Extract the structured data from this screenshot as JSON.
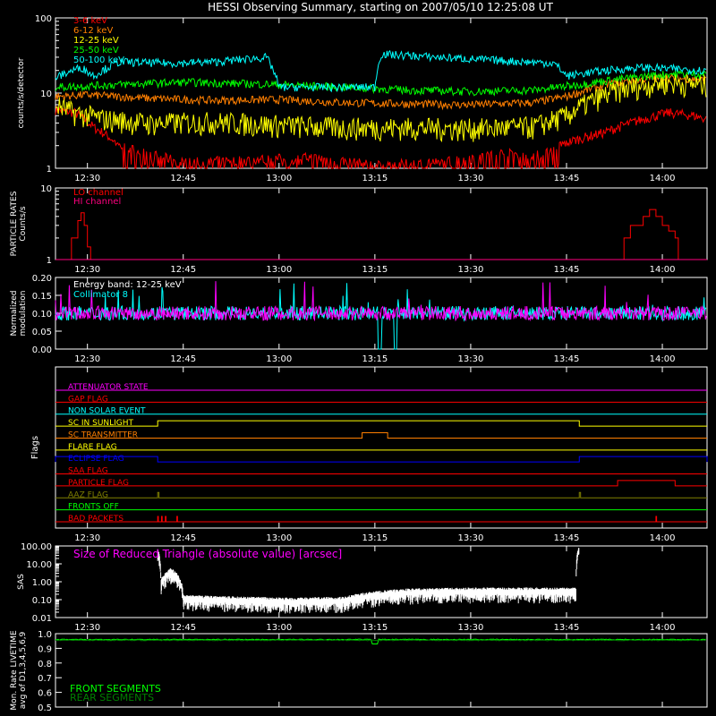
{
  "title": "HESSI Observing Summary, starting on 2007/05/10 12:25:08 UT",
  "time_axis": {
    "start_min": 0,
    "end_min": 102,
    "ticks": [
      {
        "label": "12:30",
        "min": 5
      },
      {
        "label": "12:45",
        "min": 20
      },
      {
        "label": "13:00",
        "min": 35
      },
      {
        "label": "13:15",
        "min": 50
      },
      {
        "label": "13:30",
        "min": 65
      },
      {
        "label": "13:45",
        "min": 80
      },
      {
        "label": "14:00",
        "min": 95
      }
    ]
  },
  "colors": {
    "e3_6": "#ff0000",
    "e6_12": "#ff7f00",
    "e12_25": "#ffff00",
    "e25_50": "#00ff00",
    "e50_100": "#00ffff",
    "lo": "#ff0000",
    "hi": "#ff007f",
    "magenta": "#ff00ff",
    "cyan": "#00ffff"
  },
  "chart_data": [
    {
      "type": "line",
      "ylabel": "counts/s/detector",
      "yscale": "log",
      "ylim": [
        1,
        100
      ],
      "y_ticks": [
        "1",
        "10",
        "100"
      ],
      "series": [
        {
          "name": "3-6 keV",
          "color": "#ff0000",
          "points": [
            [
              0,
              6
            ],
            [
              3,
              5.5
            ],
            [
              6,
              3.5
            ],
            [
              10,
              2
            ],
            [
              14,
              1.6
            ],
            [
              20,
              1.2
            ],
            [
              30,
              1.3
            ],
            [
              40,
              1.4
            ],
            [
              50,
              1.1
            ],
            [
              60,
              1.2
            ],
            [
              70,
              1.6
            ],
            [
              76,
              1.5
            ],
            [
              80,
              2.2
            ],
            [
              86,
              3
            ],
            [
              90,
              4
            ],
            [
              96,
              5.5
            ],
            [
              100,
              5
            ],
            [
              102,
              4.5
            ]
          ]
        },
        {
          "name": "6-12 keV",
          "color": "#ff7f00",
          "points": [
            [
              0,
              9
            ],
            [
              5,
              9.5
            ],
            [
              15,
              8.5
            ],
            [
              25,
              8
            ],
            [
              35,
              8.2
            ],
            [
              45,
              7.5
            ],
            [
              55,
              7.2
            ],
            [
              65,
              7
            ],
            [
              75,
              7.5
            ],
            [
              80,
              9
            ],
            [
              88,
              14
            ],
            [
              95,
              16
            ],
            [
              102,
              15
            ]
          ]
        },
        {
          "name": "12-25 keV",
          "color": "#ffff00",
          "points": [
            [
              0,
              7
            ],
            [
              3,
              5.5
            ],
            [
              8,
              4.5
            ],
            [
              15,
              4
            ],
            [
              25,
              4.2
            ],
            [
              35,
              3.8
            ],
            [
              45,
              3.5
            ],
            [
              55,
              3.5
            ],
            [
              65,
              3.4
            ],
            [
              75,
              3.6
            ],
            [
              80,
              5
            ],
            [
              88,
              11
            ],
            [
              95,
              14
            ],
            [
              102,
              13
            ]
          ]
        },
        {
          "name": "25-50 keV",
          "color": "#00ff00",
          "points": [
            [
              0,
              12
            ],
            [
              10,
              13
            ],
            [
              20,
              14
            ],
            [
              35,
              13
            ],
            [
              45,
              12
            ],
            [
              55,
              11
            ],
            [
              65,
              10.5
            ],
            [
              75,
              11
            ],
            [
              82,
              13
            ],
            [
              90,
              16
            ],
            [
              96,
              18
            ],
            [
              102,
              18
            ]
          ]
        },
        {
          "name": "50-100 keV",
          "color": "#00ffff",
          "points": [
            [
              0,
              16
            ],
            [
              4,
              22
            ],
            [
              6,
              17
            ],
            [
              10,
              26
            ],
            [
              18,
              25
            ],
            [
              25,
              26
            ],
            [
              33,
              30
            ],
            [
              35,
              12
            ],
            [
              50,
              12
            ],
            [
              51,
              33
            ],
            [
              60,
              30
            ],
            [
              70,
              27
            ],
            [
              78,
              25
            ],
            [
              80,
              17
            ],
            [
              86,
              20
            ],
            [
              92,
              22
            ],
            [
              102,
              20
            ]
          ]
        }
      ]
    },
    {
      "type": "line",
      "ylabel": "PARTICLE RATES",
      "ylabel2": "Counts/s",
      "yscale": "log",
      "ylim": [
        1,
        10
      ],
      "y_ticks": [
        "1",
        "10"
      ],
      "series": [
        {
          "name": "LO channel",
          "color": "#ff0000",
          "points": [
            [
              0,
              1
            ],
            [
              2,
              1
            ],
            [
              2.5,
              2
            ],
            [
              3.5,
              3.5
            ],
            [
              4,
              4.5
            ],
            [
              4.5,
              3
            ],
            [
              5,
              1.5
            ],
            [
              5.5,
              1
            ],
            [
              88,
              1
            ],
            [
              89,
              2
            ],
            [
              90,
              3
            ],
            [
              92,
              4
            ],
            [
              93,
              5
            ],
            [
              94,
              4
            ],
            [
              95,
              3
            ],
            [
              96,
              2.5
            ],
            [
              97,
              2
            ],
            [
              97.5,
              1
            ],
            [
              102,
              1
            ]
          ]
        },
        {
          "name": "HI channel",
          "color": "#ff007f",
          "points": [
            [
              0,
              1
            ],
            [
              102,
              1
            ]
          ]
        }
      ]
    },
    {
      "type": "line",
      "ylabel": "Normalized",
      "ylabel2": "modulation",
      "ylim": [
        0,
        0.2
      ],
      "y_ticks": [
        "0.00",
        "0.05",
        "0.10",
        "0.15",
        "0.20"
      ],
      "annotation": "Energy band: 12-25 keV",
      "series": [
        {
          "name": "Collimator 8",
          "color": "#00ffff",
          "mean": 0.1,
          "dropout": [
            [
              50.5,
              51
            ],
            [
              53,
              53.5
            ]
          ]
        }
      ]
    },
    {
      "type": "flags",
      "ylabel": "Flags",
      "flags": [
        {
          "name": "ATTENUATOR STATE",
          "color": "#ff00ff",
          "segments": []
        },
        {
          "name": "GAP FLAG",
          "color": "#ff0000",
          "segments": []
        },
        {
          "name": "NON SOLAR EVENT",
          "color": "#00ffff",
          "segments": []
        },
        {
          "name": "SC IN SUNLIGHT",
          "color": "#ffff00",
          "segments": [
            [
              16,
              82
            ]
          ]
        },
        {
          "name": "SC TRANSMITTER",
          "color": "#ff7f00",
          "segments": [
            [
              48,
              52
            ]
          ]
        },
        {
          "name": "FLARE FLAG",
          "color": "#ffff00",
          "segments": []
        },
        {
          "name": "ECLIPSE FLAG",
          "color": "#0000ff",
          "segments": [
            [
              0,
              16
            ],
            [
              82,
              102
            ]
          ]
        },
        {
          "name": "SAA FLAG",
          "color": "#ff0000",
          "segments": []
        },
        {
          "name": "PARTICLE FLAG",
          "color": "#ff0000",
          "segments": [
            [
              88,
              97
            ]
          ]
        },
        {
          "name": "AAZ FLAG",
          "color": "#808000",
          "segments": [
            [
              16,
              16.2
            ],
            [
              82,
              82.2
            ]
          ]
        },
        {
          "name": "FRONTS OFF",
          "color": "#00ff00",
          "segments": []
        },
        {
          "name": "BAD PACKETS",
          "color": "#ff0000",
          "segments": [
            [
              16,
              16.1
            ],
            [
              16.6,
              16.7
            ],
            [
              17.2,
              17.3
            ],
            [
              19,
              19.1
            ],
            [
              94,
              94.1
            ]
          ]
        }
      ]
    },
    {
      "type": "line",
      "ylabel": "SAS",
      "yscale": "log",
      "ylim": [
        0.01,
        100
      ],
      "y_ticks": [
        "0.01",
        "0.10",
        "1.00",
        "10.00",
        "100.00"
      ],
      "annotation": "Size of Reduced Triangle (absolute value) [arcsec]",
      "series": [
        {
          "name": "SAS",
          "color": "#ffffff",
          "start": 16,
          "end": 82,
          "points": [
            [
              16,
              60
            ],
            [
              16.5,
              1
            ],
            [
              18,
              5
            ],
            [
              20,
              0.15
            ],
            [
              35,
              0.11
            ],
            [
              45,
              0.12
            ],
            [
              50,
              0.25
            ],
            [
              55,
              0.35
            ],
            [
              65,
              0.4
            ],
            [
              75,
              0.4
            ],
            [
              81.5,
              0.4
            ],
            [
              82,
              100
            ]
          ]
        }
      ]
    },
    {
      "type": "line",
      "ylabel": "Mon. Rate LIVETIME",
      "ylabel2": "avg of D1,3,4,5,6,9",
      "ylim": [
        0.5,
        1.0
      ],
      "y_ticks": [
        "0.5",
        "0.6",
        "0.7",
        "0.8",
        "0.9",
        "1.0"
      ],
      "series": [
        {
          "name": "FRONT SEGMENTS",
          "color": "#00ff00",
          "mean": 0.96
        },
        {
          "name": "REAR SEGMENTS",
          "color": "#008000",
          "mean": 0.955
        }
      ]
    }
  ]
}
